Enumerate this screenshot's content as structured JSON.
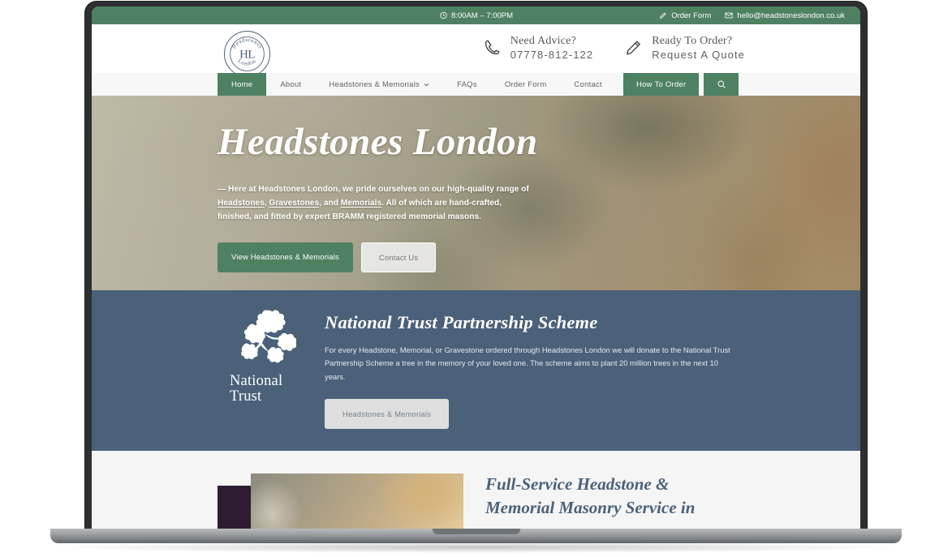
{
  "topbar": {
    "hours": "8:00AM – 7:00PM",
    "hours_icon": "clock-icon",
    "order_form": "Order Form",
    "order_form_icon": "pencil-icon",
    "email": "hello@headstoneslondon.co.uk",
    "email_icon": "envelope-icon",
    "bg": "#4e8162"
  },
  "header": {
    "logo": {
      "top_text": "Headstones",
      "monogram": "HL",
      "bottom_text": "London"
    },
    "contacts": [
      {
        "icon": "phone-icon",
        "title": "Need Advice?",
        "value": "07778-812-122"
      },
      {
        "icon": "pencil-icon",
        "title": "Ready To Order?",
        "value": "Request A Quote"
      }
    ]
  },
  "nav": {
    "items": [
      {
        "label": "Home",
        "active": true,
        "dropdown": false
      },
      {
        "label": "About",
        "active": false,
        "dropdown": false
      },
      {
        "label": "Headstones & Memorials",
        "active": false,
        "dropdown": true
      },
      {
        "label": "FAQs",
        "active": false,
        "dropdown": false
      },
      {
        "label": "Order Form",
        "active": false,
        "dropdown": false
      },
      {
        "label": "Contact",
        "active": false,
        "dropdown": false
      }
    ],
    "cta_label": "How To Order",
    "search_icon": "search-icon",
    "accent": "#4e8162"
  },
  "hero": {
    "title": "Headstones London",
    "copy_prefix": "— Here at Headstones London, we pride ourselves on our high-quality range of ",
    "link_1": "Headstones",
    "copy_mid_1": ", ",
    "link_2": "Gravestones",
    "copy_mid_2": ", and ",
    "link_3": "Memorials",
    "copy_suffix": ". All of which are hand-crafted, finished, and fitted by expert BRAMM registered memorial masons.",
    "primary_button": "View Headstones & Memorials",
    "secondary_button": "Contact Us"
  },
  "national_trust": {
    "logo_line_1": "National",
    "logo_line_2": "Trust",
    "logo_icon": "oak-leaf-sprig-icon",
    "title": "National Trust Partnership Scheme",
    "copy": "For every Headstone, Memorial, or Gravestone ordered through Headstones London we will donate to the National Trust Partnership Scheme a tree in the memory of your loved one. The scheme aims to plant 20 million trees in the next 10 years.",
    "button": "Headstones & Memorials",
    "bg": "#4a6179"
  },
  "lower_section": {
    "title": "Full-Service Headstone & Memorial Masonry Service in"
  }
}
